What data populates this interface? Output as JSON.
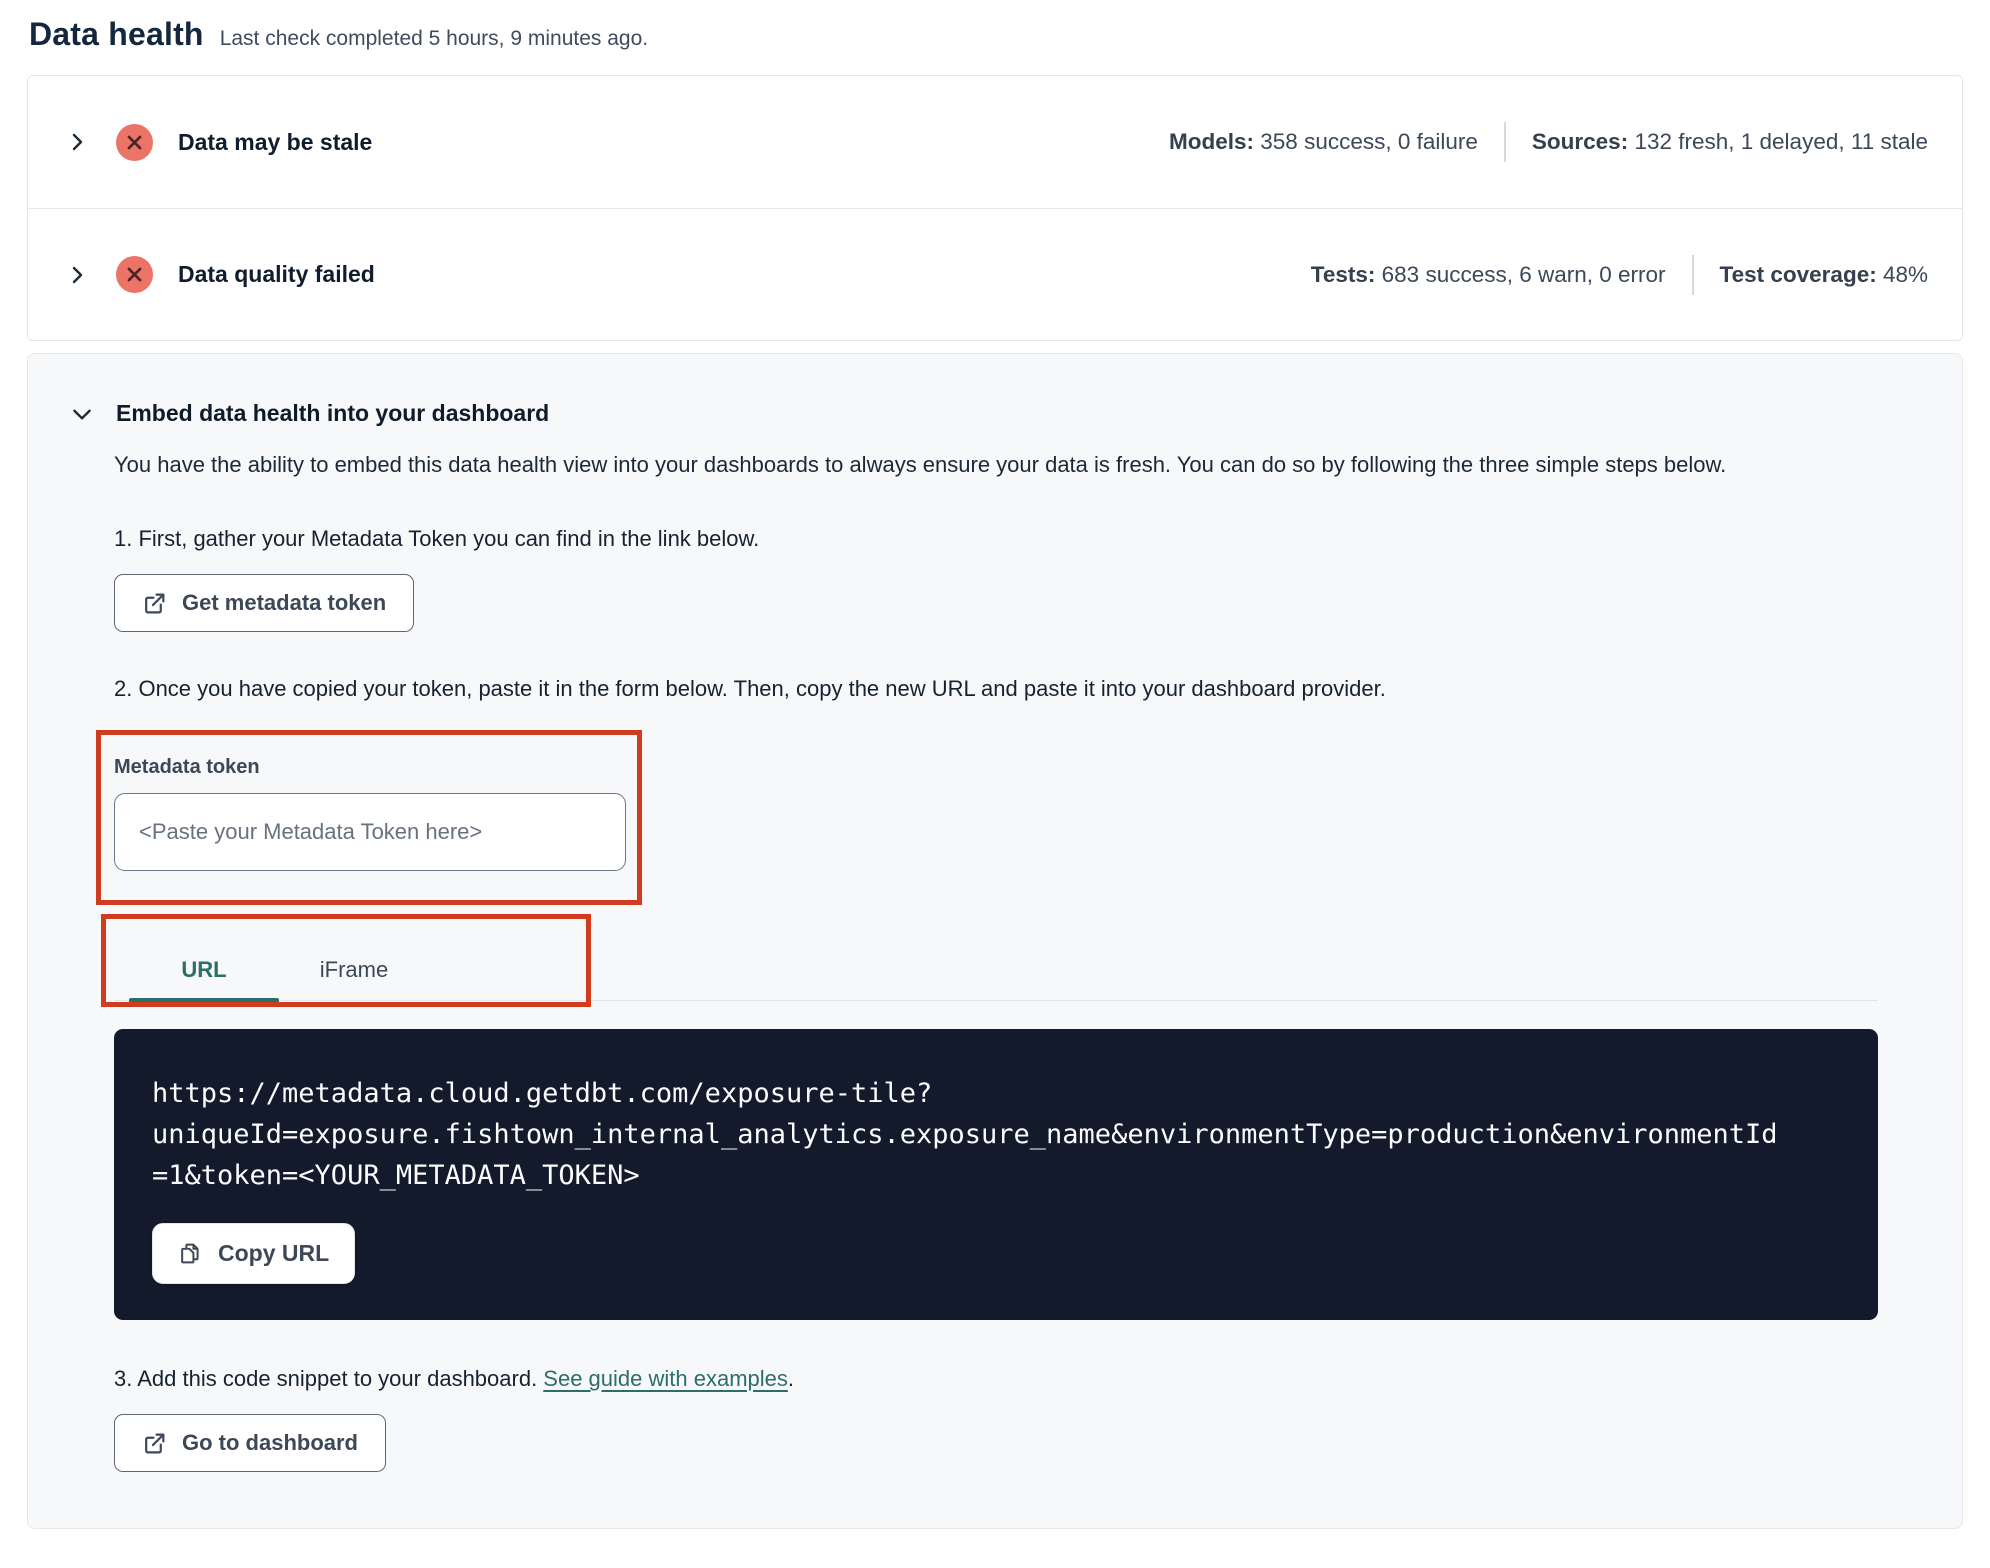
{
  "page": {
    "title": "Data health",
    "subtitle": "Last check completed 5 hours, 9 minutes ago."
  },
  "status_rows": [
    {
      "label": "Data may be stale",
      "icon": "x-circle-error-icon",
      "stats": [
        {
          "label": "Models:",
          "value": " 358 success, 0 failure"
        },
        {
          "label": "Sources:",
          "value": " 132 fresh, 1 delayed, 11 stale"
        }
      ]
    },
    {
      "label": "Data quality failed",
      "icon": "x-circle-error-icon",
      "stats": [
        {
          "label": "Tests:",
          "value": " 683 success, 6 warn, 0 error"
        },
        {
          "label": "Test coverage:",
          "value": " 48%"
        }
      ]
    }
  ],
  "embed_section": {
    "title": "Embed data health into your dashboard",
    "description": "You have the ability to embed this data health view into your dashboards to always ensure your data is fresh. You can do so by following the three simple steps below.",
    "step1": {
      "text": "1. First, gather your Metadata Token you can find in the link below.",
      "button_label": "Get metadata token"
    },
    "step2": {
      "text": "2. Once you have copied your token, paste it in the form below. Then, copy the new URL and paste it into your dashboard provider.",
      "token_field": {
        "label": "Metadata token",
        "value": "",
        "placeholder": "<Paste your Metadata Token here>"
      },
      "tabs": [
        {
          "label": "URL",
          "active": true
        },
        {
          "label": "iFrame",
          "active": false
        }
      ],
      "code": "https://metadata.cloud.getdbt.com/exposure-tile?\nuniqueId=exposure.fishtown_internal_analytics.exposure_name&environmentType=production&environmentId\n=1&token=<YOUR_METADATA_TOKEN>",
      "copy_button_label": "Copy URL"
    },
    "step3": {
      "text_before_link": "3. Add this code snippet to your dashboard. ",
      "link_label": "See guide with examples",
      "text_after_link": ".",
      "button_label": "Go to dashboard"
    }
  },
  "colors": {
    "accent_teal": "#2d6e69",
    "annotation_red": "#d23c1e",
    "error_badge_bg": "#ec7467",
    "error_badge_glyph": "#46262e",
    "code_block_bg": "#131a2b",
    "section_bg": "#f7f8f9"
  }
}
